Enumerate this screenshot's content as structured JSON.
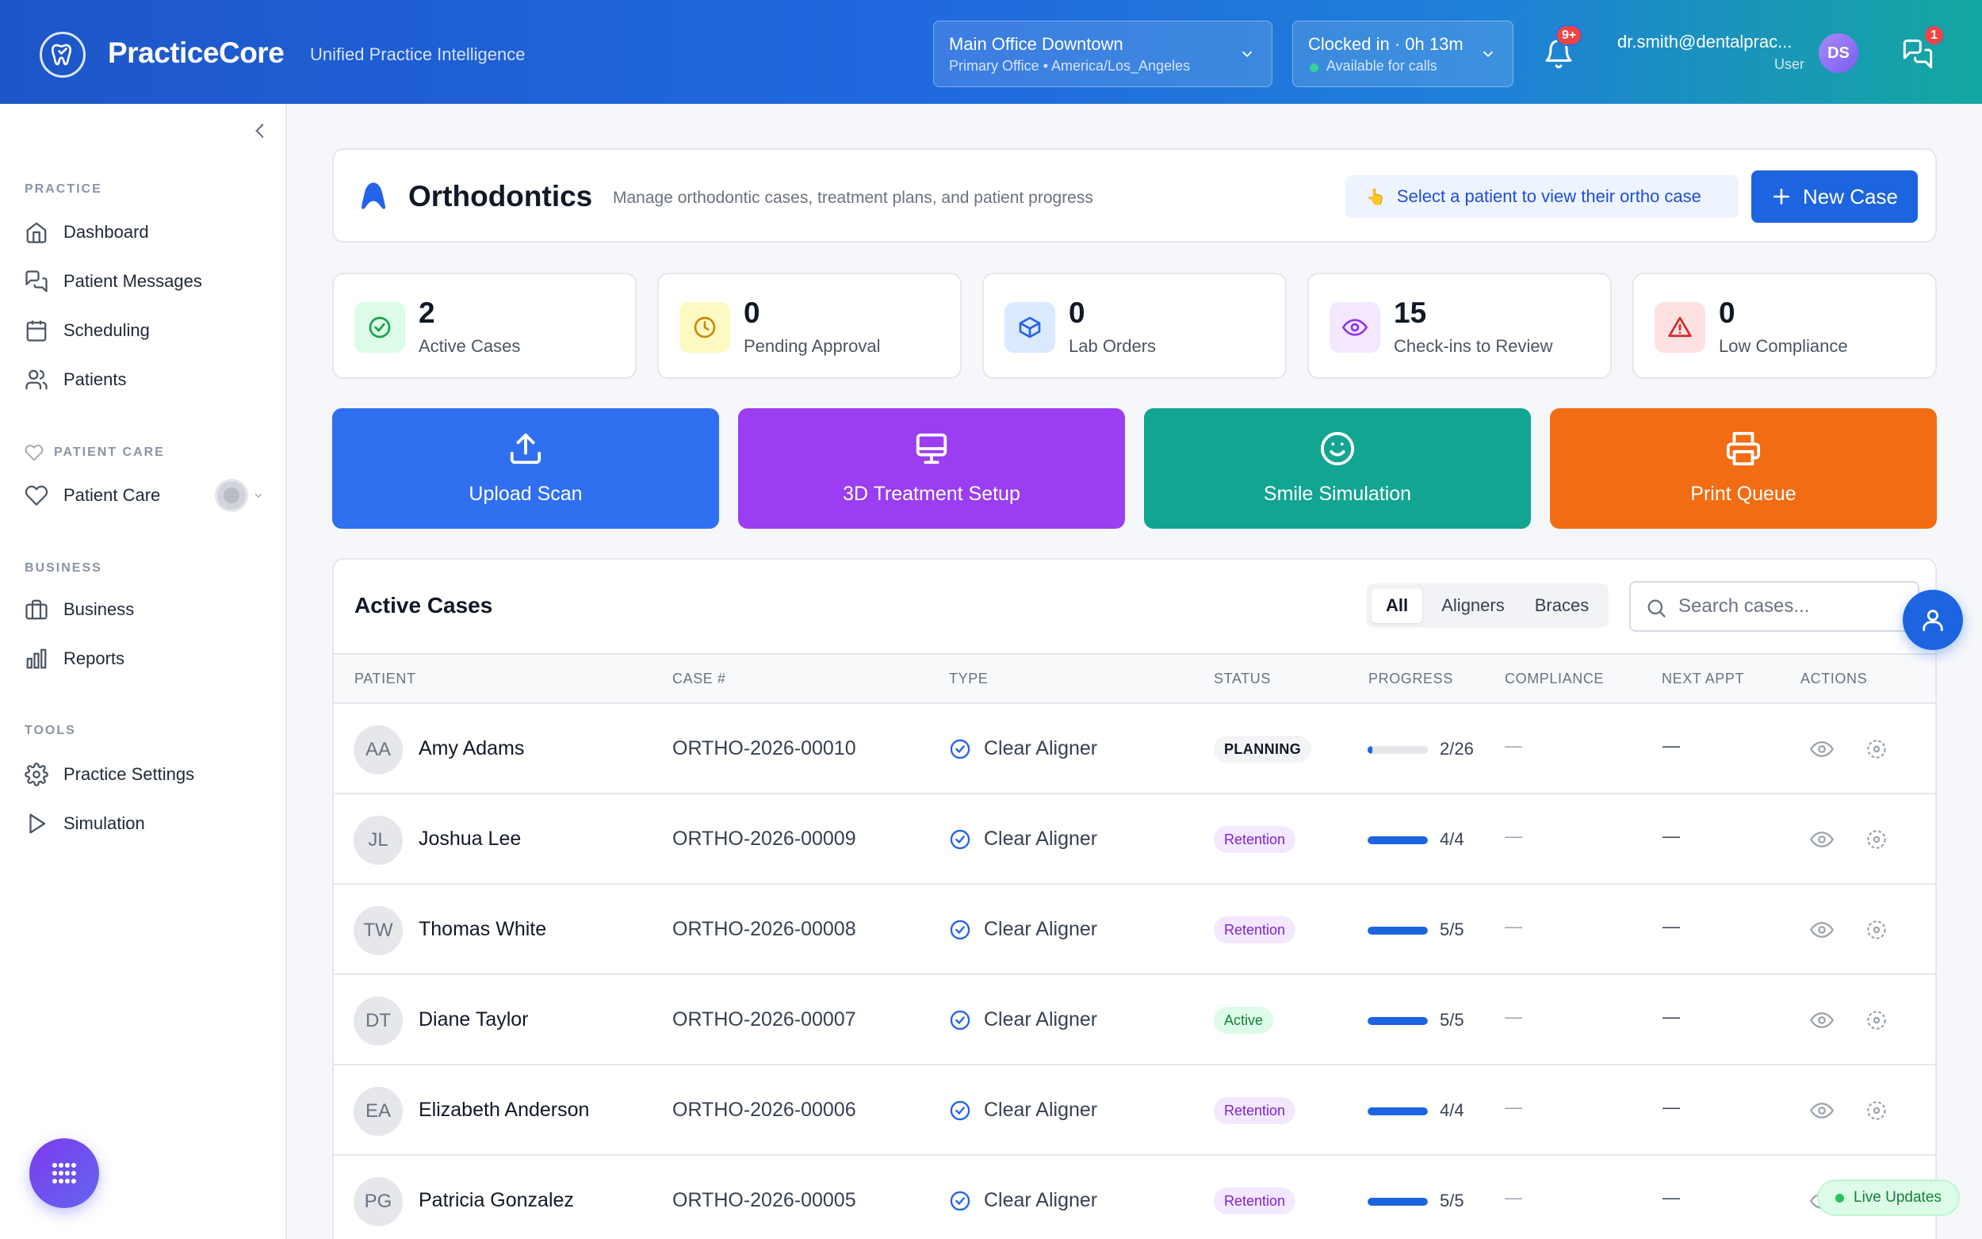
{
  "header": {
    "brand": "PracticeCore",
    "tagline": "Unified Practice Intelligence",
    "office": {
      "name": "Main Office Downtown",
      "detail": "Primary Office • America/Los_Angeles"
    },
    "clock": {
      "status": "Clocked in · 0h 13m",
      "availability": "Available for calls"
    },
    "notifications_badge": "9+",
    "user": {
      "email": "dr.smith@dentalprac...",
      "role": "User",
      "initials": "DS"
    },
    "messages_badge": "1"
  },
  "sidebar": {
    "sections": {
      "practice": "PRACTICE",
      "patient_care": "PATIENT CARE",
      "business": "BUSINESS",
      "tools": "TOOLS"
    },
    "items": {
      "dashboard": "Dashboard",
      "patient_messages": "Patient Messages",
      "scheduling": "Scheduling",
      "patients": "Patients",
      "patient_care": "Patient Care",
      "business": "Business",
      "reports": "Reports",
      "practice_settings": "Practice Settings",
      "simulation": "Simulation"
    }
  },
  "page": {
    "title": "Orthodontics",
    "description": "Manage orthodontic cases, treatment plans, and patient progress",
    "hint": "Select a patient to view their ortho case",
    "hint_emoji": "👆",
    "new_case_label": "New Case"
  },
  "stats": [
    {
      "value": "2",
      "label": "Active Cases",
      "icon": "check-circle-icon",
      "color": "#16a34a",
      "bg": "#dcfce7"
    },
    {
      "value": "0",
      "label": "Pending Approval",
      "icon": "clock-icon",
      "color": "#ca8a04",
      "bg": "#fef9c3"
    },
    {
      "value": "0",
      "label": "Lab Orders",
      "icon": "box-icon",
      "color": "#2563eb",
      "bg": "#dbeafe"
    },
    {
      "value": "15",
      "label": "Check-ins to Review",
      "icon": "eye-icon",
      "color": "#9333ea",
      "bg": "#f3e8ff"
    },
    {
      "value": "0",
      "label": "Low Compliance",
      "icon": "warning-icon",
      "color": "#dc2626",
      "bg": "#fee2e2"
    }
  ],
  "actions": [
    {
      "label": "Upload Scan",
      "icon": "upload-icon",
      "color": "#2f6ff0"
    },
    {
      "label": "3D Treatment Setup",
      "icon": "monitor-icon",
      "color": "#9b3df0"
    },
    {
      "label": "Smile Simulation",
      "icon": "smile-icon",
      "color": "#12a591"
    },
    {
      "label": "Print Queue",
      "icon": "printer-icon",
      "color": "#f26c14"
    }
  ],
  "cases_table": {
    "title": "Active Cases",
    "filters": [
      "All",
      "Aligners",
      "Braces"
    ],
    "active_filter": "All",
    "search_placeholder": "Search cases...",
    "columns": [
      "PATIENT",
      "CASE #",
      "TYPE",
      "STATUS",
      "PROGRESS",
      "COMPLIANCE",
      "NEXT APPT",
      "ACTIONS"
    ],
    "rows": [
      {
        "initials": "AA",
        "name": "Amy Adams",
        "case": "ORTHO-2026-00010",
        "type": "Clear Aligner",
        "status": "PLANNING",
        "status_kind": "planning",
        "progress_text": "2/26",
        "progress": 0.077,
        "compliance": "—",
        "next_appt": "—"
      },
      {
        "initials": "JL",
        "name": "Joshua Lee",
        "case": "ORTHO-2026-00009",
        "type": "Clear Aligner",
        "status": "Retention",
        "status_kind": "retention",
        "progress_text": "4/4",
        "progress": 1,
        "compliance": "—",
        "next_appt": "—"
      },
      {
        "initials": "TW",
        "name": "Thomas White",
        "case": "ORTHO-2026-00008",
        "type": "Clear Aligner",
        "status": "Retention",
        "status_kind": "retention",
        "progress_text": "5/5",
        "progress": 1,
        "compliance": "—",
        "next_appt": "—"
      },
      {
        "initials": "DT",
        "name": "Diane Taylor",
        "case": "ORTHO-2026-00007",
        "type": "Clear Aligner",
        "status": "Active",
        "status_kind": "active",
        "progress_text": "5/5",
        "progress": 1,
        "compliance": "—",
        "next_appt": "—"
      },
      {
        "initials": "EA",
        "name": "Elizabeth Anderson",
        "case": "ORTHO-2026-00006",
        "type": "Clear Aligner",
        "status": "Retention",
        "status_kind": "retention",
        "progress_text": "4/4",
        "progress": 1,
        "compliance": "—",
        "next_appt": "—"
      },
      {
        "initials": "PG",
        "name": "Patricia Gonzalez",
        "case": "ORTHO-2026-00005",
        "type": "Clear Aligner",
        "status": "Retention",
        "status_kind": "retention",
        "progress_text": "5/5",
        "progress": 1,
        "compliance": "—",
        "next_appt": "—"
      }
    ]
  },
  "live_updates": "Live Updates"
}
